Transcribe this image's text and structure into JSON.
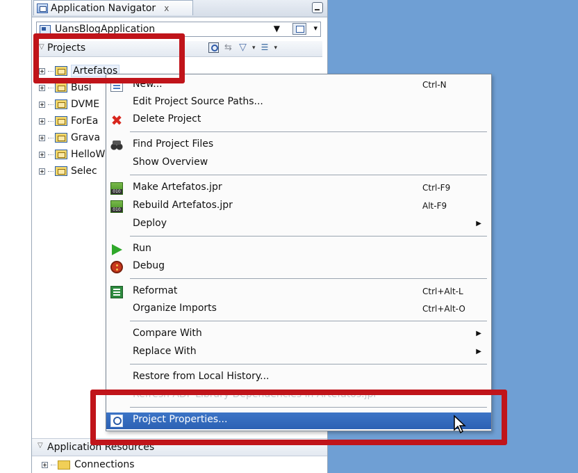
{
  "panel": {
    "tab_title": "Application Navigator",
    "tab_close": "x",
    "application": "UansBlogApplication",
    "projects_label": "Projects",
    "projects": [
      {
        "name": "Artefatos"
      },
      {
        "name": "Busi"
      },
      {
        "name": "DVME"
      },
      {
        "name": "ForEa"
      },
      {
        "name": "Grava"
      },
      {
        "name": "HelloW"
      },
      {
        "name": "Selec"
      }
    ],
    "app_resources_label": "Application Resources",
    "connections_label": "Connections"
  },
  "menu": {
    "items": [
      {
        "label": "New...",
        "shortcut": "Ctrl-N",
        "icon": "new-icon"
      },
      {
        "label": "Edit Project Source Paths...",
        "shortcut": ""
      },
      {
        "label": "Delete Project",
        "shortcut": "",
        "icon": "delete-icon"
      },
      {
        "label": "Find Project Files",
        "shortcut": "",
        "icon": "binoculars-icon"
      },
      {
        "label": "Show Overview",
        "shortcut": ""
      },
      {
        "label": "Make Artefatos.jpr",
        "shortcut": "Ctrl-F9",
        "icon": "make-icon"
      },
      {
        "label": "Rebuild Artefatos.jpr",
        "shortcut": "Alt-F9",
        "icon": "rebuild-icon"
      },
      {
        "label": "Deploy",
        "shortcut": "",
        "submenu": true
      },
      {
        "label": "Run",
        "shortcut": "",
        "icon": "run-icon"
      },
      {
        "label": "Debug",
        "shortcut": "",
        "icon": "debug-icon"
      },
      {
        "label": "Reformat",
        "shortcut": "Ctrl+Alt-L",
        "icon": "reformat-icon"
      },
      {
        "label": "Organize Imports",
        "shortcut": "Ctrl+Alt-O"
      },
      {
        "label": "Compare With",
        "shortcut": "",
        "submenu": true
      },
      {
        "label": "Replace With",
        "shortcut": "",
        "submenu": true
      },
      {
        "label": "Restore from Local History...",
        "shortcut": ""
      },
      {
        "label": "Refresh ADF Library Dependencies in Artefatos.jpr",
        "shortcut": "",
        "disabled": true
      },
      {
        "label": "Project Properties...",
        "shortcut": "",
        "highlighted": true,
        "icon": "properties-icon"
      }
    ]
  },
  "colors": {
    "highlight_box": "#c0141a",
    "menu_highlight": "#2c61b4",
    "desktop": "#6f9fd4"
  }
}
